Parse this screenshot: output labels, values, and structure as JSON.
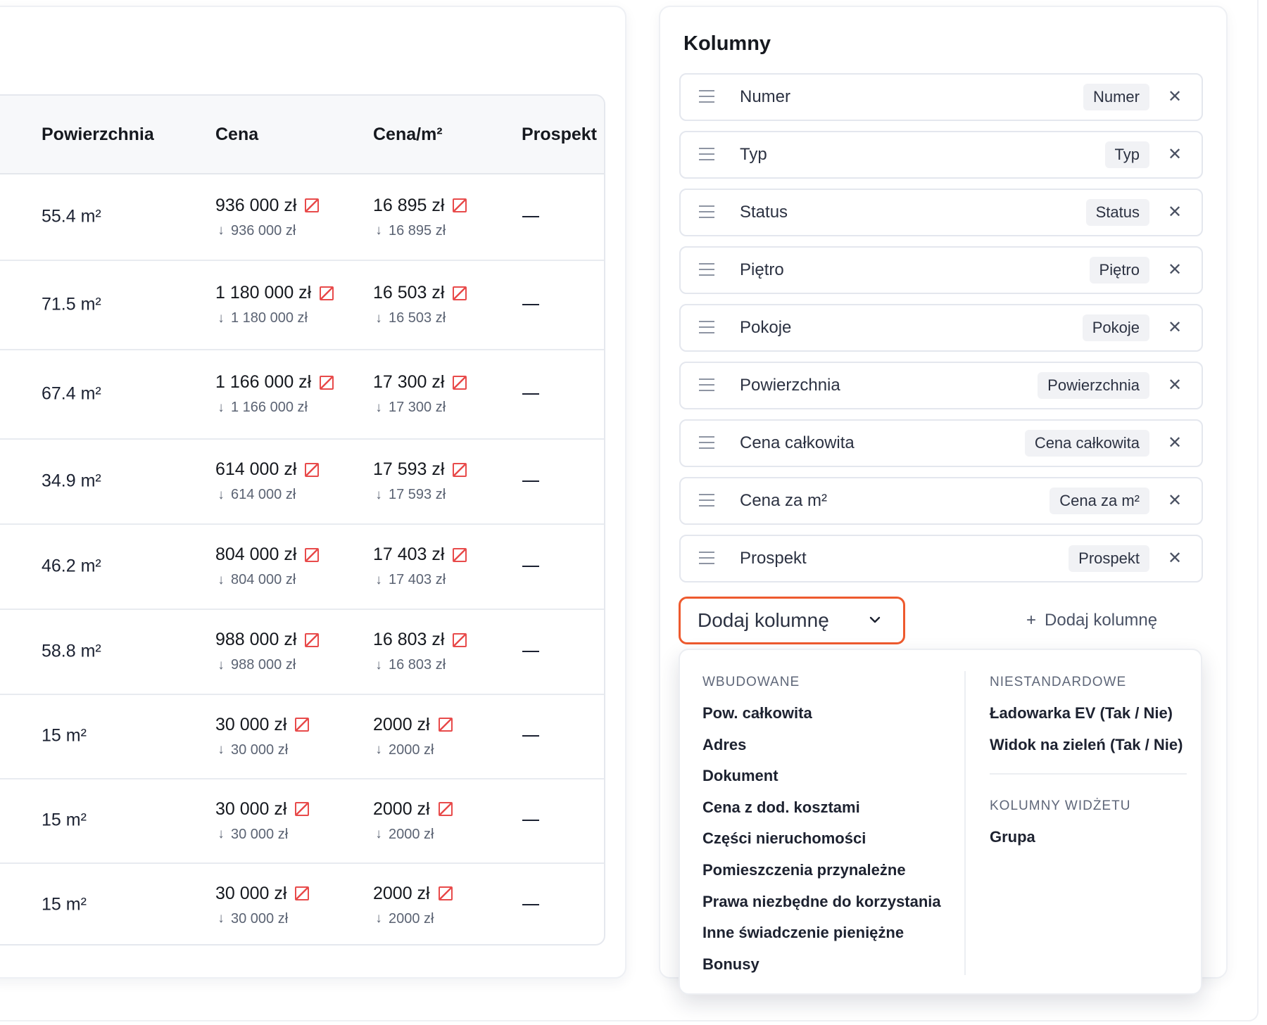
{
  "table": {
    "headers": {
      "area": "Powierzchnia",
      "price": "Cena",
      "price_m2": "Cena/m²",
      "prospect": "Prospekt"
    },
    "rows": [
      {
        "area": "55.4 m²",
        "price": "936 000 zł",
        "price_prev": "936 000 zł",
        "price_m2": "16 895 zł",
        "price_m2_prev": "16 895 zł",
        "prospect": "—"
      },
      {
        "area": "71.5 m²",
        "price": "1 180 000 zł",
        "price_prev": "1 180 000 zł",
        "price_m2": "16 503 zł",
        "price_m2_prev": "16 503 zł",
        "prospect": "—"
      },
      {
        "area": "67.4 m²",
        "price": "1 166 000 zł",
        "price_prev": "1 166 000 zł",
        "price_m2": "17 300 zł",
        "price_m2_prev": "17 300 zł",
        "prospect": "—"
      },
      {
        "area": "34.9 m²",
        "price": "614 000 zł",
        "price_prev": "614 000 zł",
        "price_m2": "17 593 zł",
        "price_m2_prev": "17 593 zł",
        "prospect": "—"
      },
      {
        "area": "46.2 m²",
        "price": "804 000 zł",
        "price_prev": "804 000 zł",
        "price_m2": "17 403 zł",
        "price_m2_prev": "17 403 zł",
        "prospect": "—"
      },
      {
        "area": "58.8 m²",
        "price": "988 000 zł",
        "price_prev": "988 000 zł",
        "price_m2": "16 803 zł",
        "price_m2_prev": "16 803 zł",
        "prospect": "—"
      },
      {
        "area": "15 m²",
        "price": "30 000 zł",
        "price_prev": "30 000 zł",
        "price_m2": "2000 zł",
        "price_m2_prev": "2000 zł",
        "prospect": "—"
      },
      {
        "area": "15 m²",
        "price": "30 000 zł",
        "price_prev": "30 000 zł",
        "price_m2": "2000 zł",
        "price_m2_prev": "2000 zł",
        "prospect": "—"
      },
      {
        "area": "15 m²",
        "price": "30 000 zł",
        "price_prev": "30 000 zł",
        "price_m2": "2000 zł",
        "price_m2_prev": "2000 zł",
        "prospect": "—"
      }
    ]
  },
  "panel": {
    "title": "Kolumny",
    "columns": [
      {
        "label": "Numer",
        "tag": "Numer"
      },
      {
        "label": "Typ",
        "tag": "Typ"
      },
      {
        "label": "Status",
        "tag": "Status"
      },
      {
        "label": "Piętro",
        "tag": "Piętro"
      },
      {
        "label": "Pokoje",
        "tag": "Pokoje"
      },
      {
        "label": "Powierzchnia",
        "tag": "Powierzchnia"
      },
      {
        "label": "Cena całkowita",
        "tag": "Cena całkowita"
      },
      {
        "label": "Cena za m²",
        "tag": "Cena za m²"
      },
      {
        "label": "Prospekt",
        "tag": "Prospekt"
      }
    ],
    "add_select_label": "Dodaj kolumnę",
    "add_link_label": "Dodaj kolumnę",
    "dropdown": {
      "builtin_heading": "WBUDOWANE",
      "builtin_items": [
        "Pow.  całkowita",
        "Adres",
        "Dokument",
        "Cena z dod. kosztami",
        "Części nieruchomości",
        "Pomieszczenia przynależne",
        "Prawa niezbędne do korzystania",
        "Inne świadczenie pieniężne",
        "Bonusy"
      ],
      "custom_heading": "NIESTANDARDOWE",
      "custom_items": [
        "Ładowarka EV (Tak / Nie)",
        "Widok na zieleń (Tak / Nie)"
      ],
      "widget_heading": "KOLUMNY WIDŻETU",
      "widget_items": [
        "Grupa"
      ]
    }
  },
  "icons": {
    "edit": "edit-icon",
    "arrow_down": "arrow-down-icon",
    "drag_handle": "drag-handle-icon",
    "close": "close-icon",
    "chevron": "chevron-down-icon",
    "plus": "plus-icon"
  },
  "colors": {
    "accent": "#ee5a2e",
    "edit_icon": "#e84b4b"
  }
}
